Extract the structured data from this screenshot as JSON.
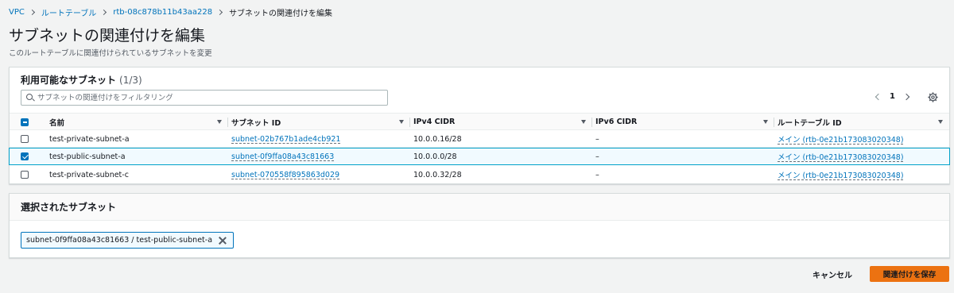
{
  "breadcrumb": {
    "items": [
      "VPC",
      "ルートテーブル",
      "rtb-08c878b11b43aa228"
    ],
    "current": "サブネットの関連付けを編集"
  },
  "page": {
    "title": "サブネットの関連付けを編集",
    "description": "このルートテーブルに関連付けられているサブネットを変更"
  },
  "available": {
    "title": "利用可能なサブネット",
    "count": "(1/3)",
    "filter_placeholder": "サブネットの関連付けをフィルタリング",
    "page_number": "1",
    "columns": [
      "名前",
      "サブネット ID",
      "IPv4 CIDR",
      "IPv6 CIDR",
      "ルートテーブル ID"
    ],
    "rows": [
      {
        "name": "test-private-subnet-a",
        "subnet_id": "subnet-02b767b1ade4cb921",
        "ipv4": "10.0.0.16/28",
        "ipv6": "–",
        "route_table": "メイン (rtb-0e21b173083020348)",
        "selected": false
      },
      {
        "name": "test-public-subnet-a",
        "subnet_id": "subnet-0f9ffa08a43c81663",
        "ipv4": "10.0.0.0/28",
        "ipv6": "–",
        "route_table": "メイン (rtb-0e21b173083020348)",
        "selected": true
      },
      {
        "name": "test-private-subnet-c",
        "subnet_id": "subnet-070558f895863d029",
        "ipv4": "10.0.0.32/28",
        "ipv6": "–",
        "route_table": "メイン (rtb-0e21b173083020348)",
        "selected": false
      }
    ]
  },
  "selected_section": {
    "title": "選択されたサブネット",
    "token": "subnet-0f9ffa08a43c81663 / test-public-subnet-a"
  },
  "actions": {
    "cancel": "キャンセル",
    "save": "関連付けを保存"
  },
  "colors": {
    "link": "#0073bb",
    "primary_button": "#ec7211",
    "selected_row_border": "#00a1c9"
  }
}
